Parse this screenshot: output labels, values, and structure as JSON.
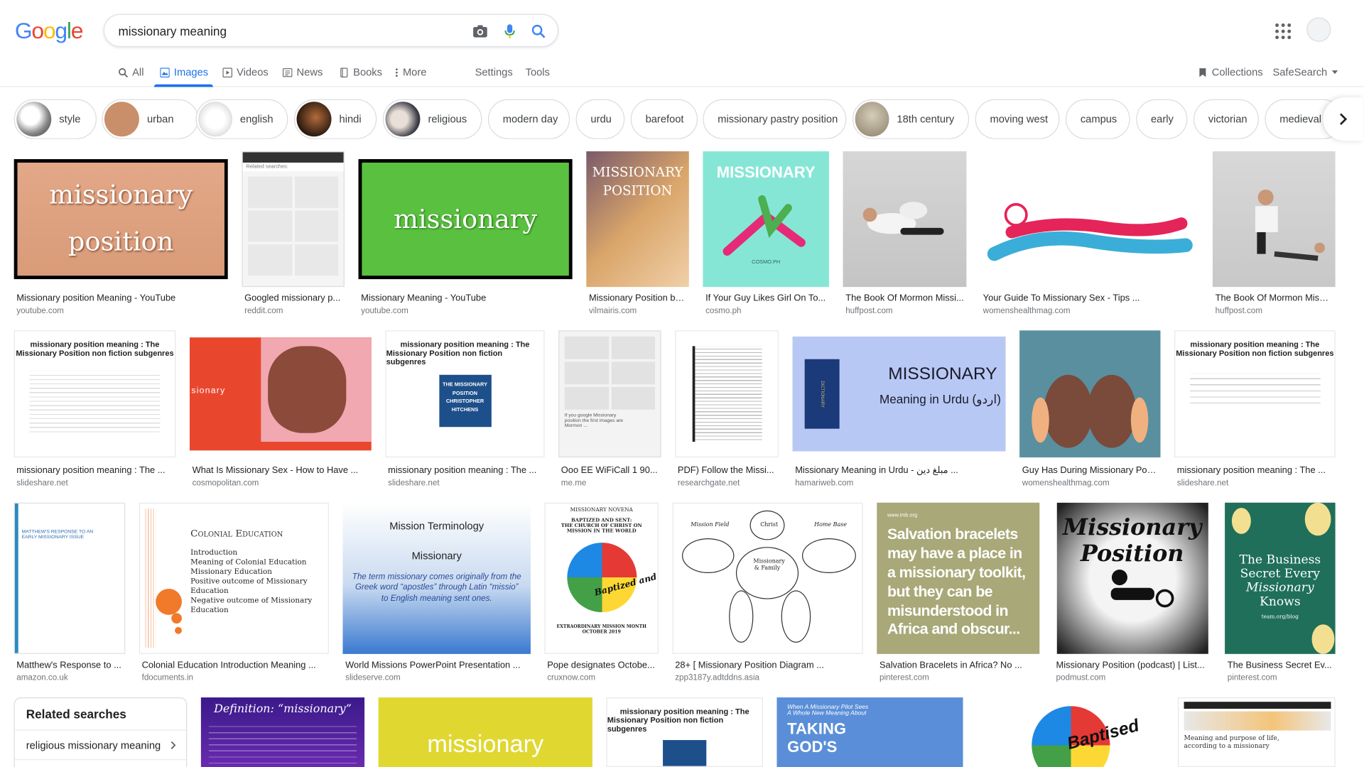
{
  "header": {
    "logo": [
      "G",
      "o",
      "o",
      "g",
      "l",
      "e"
    ],
    "query": "missionary meaning"
  },
  "tabs": [
    {
      "label": "All",
      "icon": "search-icon"
    },
    {
      "label": "Images",
      "icon": "image-icon",
      "active": true
    },
    {
      "label": "Videos",
      "icon": "video-icon"
    },
    {
      "label": "News",
      "icon": "news-icon"
    },
    {
      "label": "Books",
      "icon": "book-icon"
    },
    {
      "label": "More",
      "icon": "more-vert-icon"
    },
    {
      "label": "Settings"
    },
    {
      "label": "Tools"
    }
  ],
  "right_tools": {
    "collections": "Collections",
    "safesearch": "SafeSearch"
  },
  "chips": [
    "style",
    "urban",
    "english",
    "hindi",
    "religious",
    "modern day",
    "urdu",
    "barefoot",
    "missionary pastry position",
    "18th century",
    "moving west",
    "campus",
    "early",
    "victorian",
    "medieval"
  ],
  "results_row1": [
    {
      "title": "Missionary position Meaning - YouTube",
      "source": "youtube.com",
      "thumb_text": [
        "missionary",
        "position"
      ]
    },
    {
      "title": "Googled missionary p...",
      "source": "reddit.com",
      "thumb_text": [
        "Related searches:"
      ]
    },
    {
      "title": "Missionary Meaning - YouTube",
      "source": "youtube.com",
      "thumb_text": [
        "missionary"
      ]
    },
    {
      "title": "Missionary Position by...",
      "source": "vilmairis.com",
      "thumb_text": [
        "MISSIONARY",
        "POSITION"
      ]
    },
    {
      "title": "If Your Guy Likes Girl On To...",
      "source": "cosmo.ph",
      "thumb_text": [
        "MISSIONARY",
        "COSMO.PH"
      ]
    },
    {
      "title": "The Book Of Mormon Missi...",
      "source": "huffpost.com",
      "thumb_text": []
    },
    {
      "title": "Your Guide To Missionary Sex - Tips ...",
      "source": "womenshealthmag.com",
      "thumb_text": []
    },
    {
      "title": "The Book Of Mormon Missi...",
      "source": "huffpost.com",
      "thumb_text": []
    }
  ],
  "results_row2": [
    {
      "title": "missionary position meaning : The ...",
      "source": "slideshare.net",
      "thumb_text": [
        "missionary position meaning : The",
        "Missionary Position non fiction subgenres"
      ]
    },
    {
      "title": "What Is Missionary Sex - How to Have ...",
      "source": "cosmopolitan.com",
      "thumb_text": [
        "sionary"
      ]
    },
    {
      "title": "missionary position meaning : The ...",
      "source": "slideshare.net",
      "thumb_text": [
        "missionary position meaning : The",
        "Missionary Position non fiction subgenres",
        "THE MISSIONARY POSITION",
        "CHRISTOPHER HITCHENS"
      ]
    },
    {
      "title": "Ooo EE WiFiCall 1 90...",
      "source": "me.me",
      "thumb_text": [
        "If you google Missionary",
        "position the first images are",
        "Mormon ..."
      ]
    },
    {
      "title": "PDF) Follow the Missi...",
      "source": "researchgate.net",
      "thumb_text": []
    },
    {
      "title": "Missionary Meaning in Urdu - مبلغ دین ...",
      "source": "hamariweb.com",
      "thumb_text": [
        "MISSIONARY",
        "Meaning in Urdu (اردو)",
        "DICTIONARY"
      ]
    },
    {
      "title": "Guy Has During Missionary Pos...",
      "source": "womenshealthmag.com",
      "thumb_text": []
    },
    {
      "title": "missionary position meaning : The ...",
      "source": "slideshare.net",
      "thumb_text": [
        "missionary position meaning : The",
        "Missionary Position non fiction subgenres"
      ]
    }
  ],
  "results_row3": [
    {
      "title": "Matthew's Response to ...",
      "source": "amazon.co.uk",
      "thumb_text": [
        "MATTHEW'S RESPONSE TO AN",
        "EARLY MISSIONARY ISSUE"
      ]
    },
    {
      "title": "Colonial Education Introduction Meaning ...",
      "source": "fdocuments.in",
      "thumb_text": [
        "Colonial Education",
        "Introduction",
        "Meaning of Colonial Education",
        "Missionary Education",
        "Positive outcome of Missionary",
        "Education",
        "Negative outcome of Missionary",
        "Education"
      ]
    },
    {
      "title": "World Missions PowerPoint Presentation ...",
      "source": "slideserve.com",
      "thumb_text": [
        "Mission Terminology",
        "Missionary",
        "The term missionary comes originally from the Greek word “apostles” through Latin “missio” to English meaning sent ones."
      ]
    },
    {
      "title": "Pope designates Octobe...",
      "source": "cruxnow.com",
      "thumb_text": [
        "MISSIONARY NOVENA",
        "BAPTIZED AND SENT:",
        "THE CHURCH OF CHRIST ON",
        "MISSION IN THE WORLD",
        "Baptized and sent",
        "EXTRAORDINARY MISSION MONTH",
        "OCTOBER 2019"
      ]
    },
    {
      "title": "28+ [ Missionary Position Diagram ...",
      "source": "zpp3187y.adtddns.asia",
      "thumb_text": [
        "Mission Field",
        "Christ",
        "Home Base",
        "Missionary & Family"
      ]
    },
    {
      "title": "Salvation Bracelets in Africa? No ...",
      "source": "pinterest.com",
      "thumb_text": [
        "www.imb.org",
        "Salvation bracelets may have a place in a missionary toolkit, but they can be misunderstood in Africa and obscur..."
      ]
    },
    {
      "title": "Missionary Position (podcast) | List...",
      "source": "podmust.com",
      "thumb_text": [
        "Missionary",
        "Position"
      ]
    },
    {
      "title": "The Business Secret Ev...",
      "source": "pinterest.com",
      "thumb_text": [
        "The Business Secret Every",
        "Missionary",
        "Knows",
        "team.org/blog"
      ]
    }
  ],
  "row4_thumb_text": {
    "definition": "Definition: “missionary”",
    "yellow": "missionary",
    "slideshare": [
      "missionary position meaning : The",
      "Missionary Position non fiction subgenres"
    ],
    "pilot": [
      "When A Missionary Pilot Sees",
      "A Whole New Meaning About",
      "TAKING",
      "GOD'S"
    ],
    "baptised": "Baptised",
    "bizmirror": [
      "Meaning and purpose of life,",
      "according to a missionary"
    ]
  },
  "related": {
    "title": "Related searches",
    "items": [
      "religious missionary meaning"
    ]
  }
}
